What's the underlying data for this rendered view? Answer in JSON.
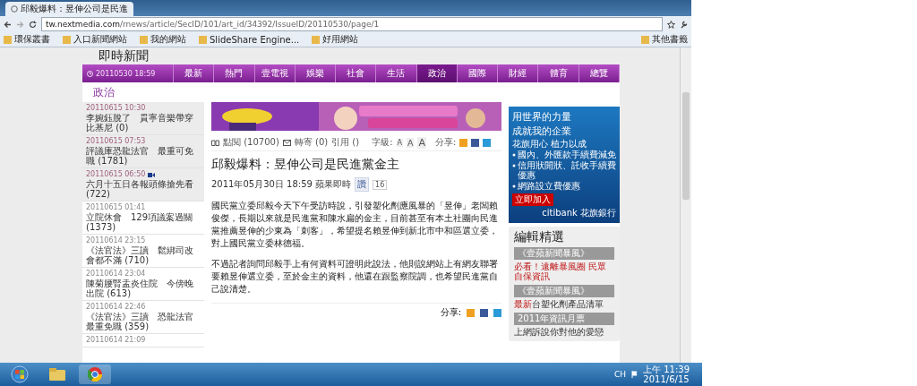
{
  "browser": {
    "tab_title": "邱毅爆料：昱伸公司是民進",
    "url_host": "tw.nextmedia.com",
    "url_path": "/rnews/article/SecID/101/art_id/34392/IssueID/20110530/page/1",
    "bookmarks": [
      "環保叢書",
      "入口新聞網站",
      "我的網站",
      "SlideShare Engine...",
      "好用網站"
    ],
    "other_bookmarks": "其他書籤"
  },
  "site": {
    "title": "即時新聞",
    "clock": "20110530 18:59",
    "nav": [
      {
        "label": "最新",
        "selected": false
      },
      {
        "label": "熱門",
        "selected": false
      },
      {
        "label": "壹電視",
        "selected": false
      },
      {
        "label": "娛樂",
        "selected": false
      },
      {
        "label": "社會",
        "selected": false
      },
      {
        "label": "生活",
        "selected": false
      },
      {
        "label": "政治",
        "selected": true
      },
      {
        "label": "國際",
        "selected": false
      },
      {
        "label": "財經",
        "selected": false
      },
      {
        "label": "體育",
        "selected": false
      },
      {
        "label": "總覽",
        "selected": false
      }
    ],
    "section": "政治"
  },
  "sidebar": [
    {
      "time": "20110615 10:30",
      "title": "李婉鈺脫了　貫寧音樂帶穿比基尼 (0)",
      "shaded": true,
      "video": false
    },
    {
      "time": "20110615 07:53",
      "title": "評議庫恐龍法官　最重可免職 (1781)",
      "shaded": true,
      "video": false
    },
    {
      "time": "20110615 06:50",
      "title": "六月十五日各報頭條搶先看 (722)",
      "shaded": true,
      "video": true
    },
    {
      "time": "20110615 01:41",
      "title": "立院休會　129項議案過關 (1373)",
      "shaded": false,
      "video": false
    },
    {
      "time": "20110614 23:15",
      "title": "《法官法》三讀　鬆綁司改會都不滿 (710)",
      "shaded": false,
      "video": false
    },
    {
      "time": "20110614 23:04",
      "title": "陳菊腰腎盂炎住院　今傍晚出院 (613)",
      "shaded": false,
      "video": false
    },
    {
      "time": "20110614 22:46",
      "title": "《法官法》三讀　恐龍法官最重免職 (359)",
      "shaded": false,
      "video": false
    },
    {
      "time": "20110614 21:09",
      "shaded": false,
      "video": false
    }
  ],
  "article": {
    "views": "點閱 (10700)",
    "forward": "轉寄 (0)",
    "cite": "引用 ()",
    "font_label": "字級:",
    "font_sizes": [
      "A",
      "A",
      "A"
    ],
    "share": "分享:",
    "headline": "邱毅爆料：昱伸公司是民進黨金主",
    "dateline": "2011年05月30日 18:59 蘋果即時",
    "like": "讚",
    "like_count": "16",
    "paragraphs": [
      "國民黨立委邱毅今天下午受訪時說，引發塑化劑應風暴的「昱伸」老闆賴俊傑，長期以來就是民進黨和陳水扁的金主，目前甚至有本土社團向民進黨推薦昱伸的少東為「刺客」，希望提名賴昱伸到新北市中和區選立委，對上國民黨立委林德福。",
      "不過記者詢問邱毅手上有何資料可證明此說法，他則說網站上有網友聯署要賴昱伸選立委，至於金主的資料，他還在跟監察院調，也希望民進黨自己說清楚。"
    ],
    "share_bottom": "分享:"
  },
  "ad": {
    "lines": [
      "用世界的力量",
      "成就我的企業"
    ],
    "tagline": "花旗用心 植力以成",
    "bullets": [
      "國內、外匯款手續費減免",
      "信用狀開狀、託收手續費優惠",
      "網路設立費優惠"
    ],
    "button": "立即加入",
    "brand": "citibank 花旗銀行"
  },
  "picks": {
    "title": "編輯精選",
    "items": [
      {
        "label": "《壹蘋新聞暴風》",
        "text": "必看！遠離暴風圈 民眾自保資訊"
      },
      {
        "label": "《壹蘋新聞暴風》",
        "highlight": "最新",
        "text": "台塑化劑產品清單"
      },
      {
        "label": "2011年資訊月票",
        "text": "上網訴說你對他的愛戀"
      }
    ]
  },
  "taskbar": {
    "lang": "CH",
    "time": "上午 11:39",
    "date": "2011/6/15"
  }
}
